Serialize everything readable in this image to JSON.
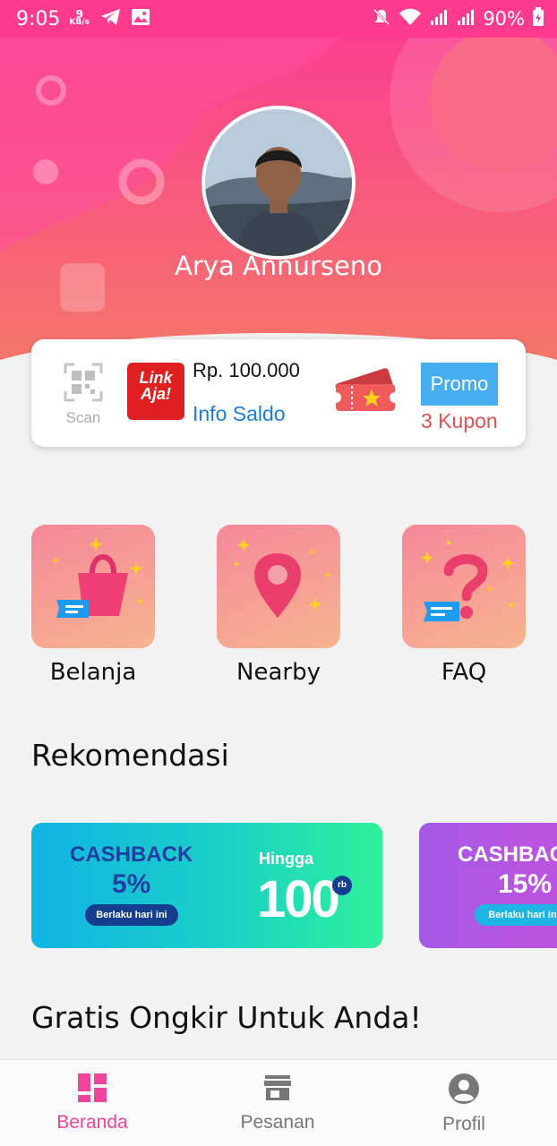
{
  "status_bar": {
    "time": "9:05",
    "net_speed_value": "9",
    "net_speed_unit": "KB/s",
    "battery": "90%",
    "icons": [
      "telegram-icon",
      "gallery-icon",
      "mute-icon",
      "wifi-icon",
      "signal-icon",
      "signal-icon",
      "battery-charging-icon"
    ]
  },
  "profile": {
    "name": "Arya Annurseno"
  },
  "wallet": {
    "scan_label": "Scan",
    "linkaja_logo_line1": "Link",
    "linkaja_logo_line2": "Aja!",
    "balance": "Rp. 100.000",
    "info_saldo": "Info Saldo",
    "promo_badge": "Promo",
    "coupons": "3 Kupon"
  },
  "features": [
    {
      "label": "Belanja",
      "icon": "shopping-bag-icon"
    },
    {
      "label": "Nearby",
      "icon": "location-pin-icon"
    },
    {
      "label": "FAQ",
      "icon": "question-mark-icon"
    }
  ],
  "sections": {
    "recommendation_title": "Rekomendasi",
    "free_shipping_title": "Gratis Ongkir Untuk Anda!"
  },
  "banners": [
    {
      "title": "CASHBACK",
      "percent": "5%",
      "pill": "Berlaku hari ini",
      "upto_label": "Hingga",
      "upto_value": "100",
      "upto_unit": "rb"
    },
    {
      "title": "CASHBACK",
      "percent": "15%",
      "pill": "Berlaku hari ini"
    }
  ],
  "bottom_nav": [
    {
      "label": "Beranda",
      "icon": "grid-icon",
      "active": true
    },
    {
      "label": "Pesanan",
      "icon": "store-icon",
      "active": false
    },
    {
      "label": "Profil",
      "icon": "account-circle-icon",
      "active": false
    }
  ],
  "colors": {
    "brand_pink": "#ff3b8e",
    "header_gradient_end": "#f4776a",
    "link_blue": "#1a7de0",
    "coupon_red": "#e05050",
    "active_nav": "#f0449a",
    "inactive_nav": "#777777"
  }
}
